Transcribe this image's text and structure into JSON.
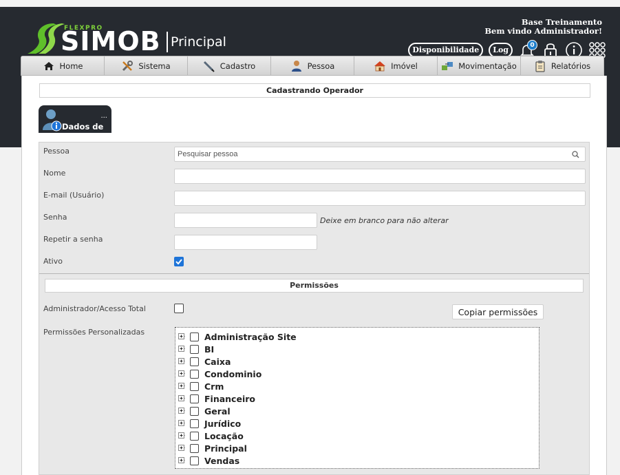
{
  "header": {
    "brand_small": "FLEXPRO",
    "brand": "SIMOB",
    "module": "Principal",
    "welcome_line1": "Base Treinamento",
    "welcome_line2": "Bem vindo Administrador!",
    "btn_disponibilidade": "Disponibilidade",
    "btn_log": "Log",
    "notification_count": "0"
  },
  "menu": [
    {
      "label": "Home",
      "icon": "home-icon"
    },
    {
      "label": "Sistema",
      "icon": "tools-icon"
    },
    {
      "label": "Cadastro",
      "icon": "pen-icon"
    },
    {
      "label": "Pessoa",
      "icon": "person-icon"
    },
    {
      "label": "Imóvel",
      "icon": "house-icon"
    },
    {
      "label": "Movimentação",
      "icon": "transfer-icon"
    },
    {
      "label": "Relatórios",
      "icon": "clipboard-icon"
    }
  ],
  "page_title": "Cadastrando Operador",
  "tab": {
    "label": "Dados de",
    "ellipsis": "..."
  },
  "form": {
    "pessoa_label": "Pessoa",
    "pessoa_placeholder": "Pesquisar pessoa",
    "nome_label": "Nome",
    "email_label": "E-mail (Usuário)",
    "senha_label": "Senha",
    "senha_hint": "Deixe em branco para não alterar",
    "repetir_label": "Repetir a senha",
    "ativo_label": "Ativo",
    "ativo_checked": true
  },
  "permissions": {
    "title": "Permissões",
    "admin_label": "Administrador/Acesso Total",
    "admin_checked": false,
    "copy_button": "Copiar permissões",
    "custom_label": "Permissões Personalizadas",
    "tree": [
      "Administração Site",
      "BI",
      "Caixa",
      "Condominio",
      "Crm",
      "Financeiro",
      "Geral",
      "Jurídico",
      "Locação",
      "Principal",
      "Vendas"
    ]
  },
  "colors": {
    "header_bg": "#262a30",
    "accent_green": "#7ed03a",
    "accent_blue": "#1e74d8"
  }
}
